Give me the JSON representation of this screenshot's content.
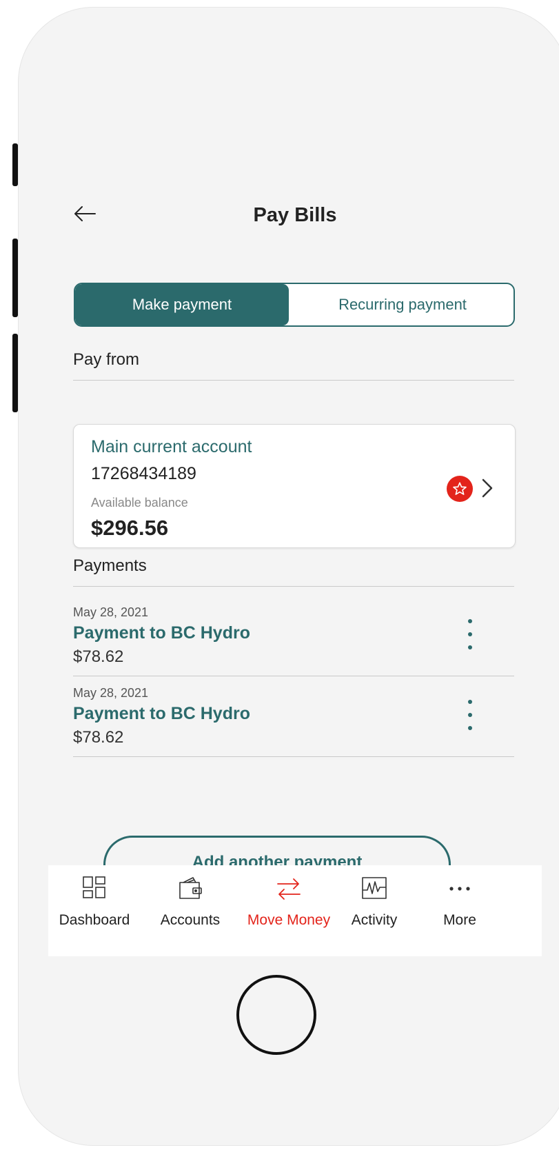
{
  "header": {
    "title": "Pay Bills",
    "back_icon": "back-arrow-icon"
  },
  "segment": {
    "active_label": "Make payment",
    "inactive_label": "Recurring payment"
  },
  "pay_from": {
    "label": "Pay from",
    "account": {
      "name": "Main current account",
      "number": "17268434189",
      "balance_label": "Available balance",
      "balance": "$296.56",
      "badge_icon": "star-icon",
      "chevron_icon": "chevron-right-icon"
    }
  },
  "payments": {
    "label": "Payments",
    "items": [
      {
        "date": "May 28, 2021",
        "title": "Payment to BC Hydro",
        "amount": "$78.62"
      },
      {
        "date": "May 28, 2021",
        "title": "Payment to BC Hydro",
        "amount": "$78.62"
      }
    ]
  },
  "add_button": {
    "label": "Add another payment"
  },
  "tabbar": {
    "items": [
      {
        "label": "Dashboard",
        "icon": "dashboard-icon"
      },
      {
        "label": "Accounts",
        "icon": "wallet-icon"
      },
      {
        "label": "Move Money",
        "icon": "transfer-icon",
        "active": true
      },
      {
        "label": "Activity",
        "icon": "activity-icon"
      },
      {
        "label": "More",
        "icon": "more-icon"
      }
    ]
  },
  "colors": {
    "brand": "#2b6a6c",
    "accent": "#e3241b",
    "background": "#f4f4f4"
  }
}
